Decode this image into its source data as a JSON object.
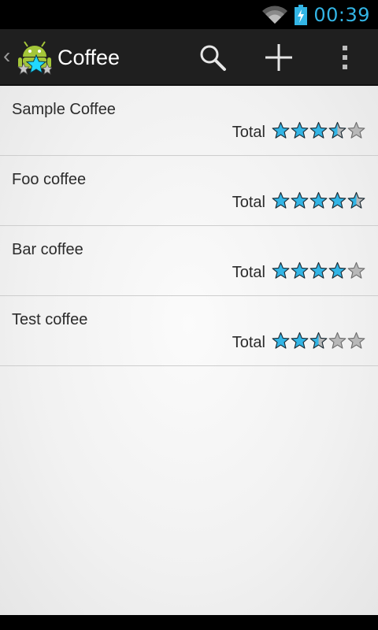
{
  "status_bar": {
    "time": "00:39",
    "icons": [
      "wifi-icon",
      "battery-charging-icon"
    ],
    "accent_color": "#33b5e5"
  },
  "action_bar": {
    "title": "Coffee",
    "app_icon": "android-star-icon",
    "actions": [
      "search-icon",
      "add-icon",
      "overflow-menu-icon"
    ]
  },
  "coffees": [
    {
      "name": "Sample Coffee",
      "total_label": "Total",
      "rating": 3.5
    },
    {
      "name": "Foo coffee",
      "total_label": "Total",
      "rating": 4.5
    },
    {
      "name": "Bar coffee",
      "total_label": "Total",
      "rating": 4
    },
    {
      "name": "Test coffee",
      "total_label": "Total",
      "rating": 2.5
    }
  ],
  "rating_max": 5,
  "colors": {
    "star_filled": "#33b5e5",
    "star_empty": "#b8b8b8",
    "star_outline": "#1b2a33"
  }
}
